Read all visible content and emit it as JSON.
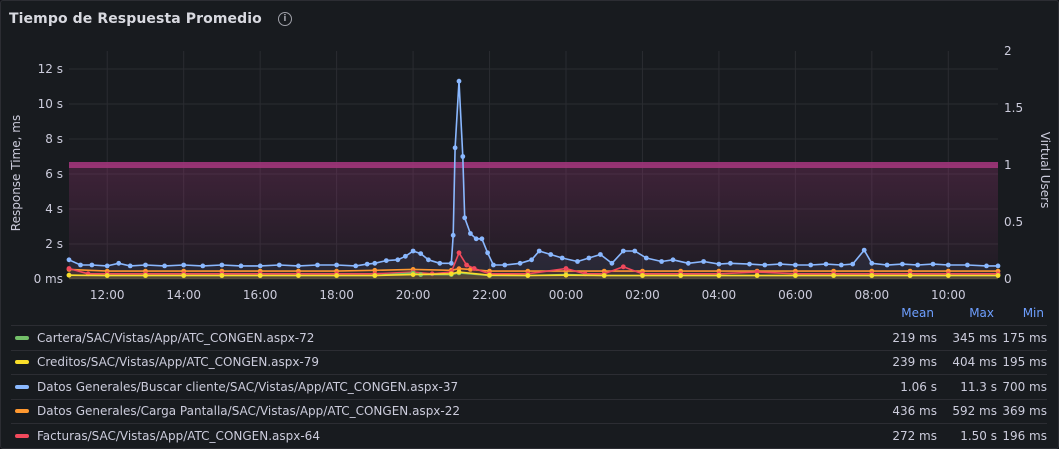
{
  "panel": {
    "title": "Tiempo de Respuesta Promedio",
    "info_icon": "info-icon"
  },
  "legend": {
    "headers": {
      "mean": "Mean",
      "max": "Max",
      "min": "Min"
    },
    "items": [
      {
        "name": "Cartera/SAC/Vistas/App/ATC_CONGEN.aspx-72",
        "color": "#73bf69",
        "mean": "219 ms",
        "max": "345 ms",
        "min": "175 ms"
      },
      {
        "name": "Creditos/SAC/Vistas/App/ATC_CONGEN.aspx-79",
        "color": "#fade2a",
        "mean": "239 ms",
        "max": "404 ms",
        "min": "195 ms"
      },
      {
        "name": "Datos Generales/Buscar cliente/SAC/Vistas/App/ATC_CONGEN.aspx-37",
        "color": "#8ab8ff",
        "mean": "1.06 s",
        "max": "11.3 s",
        "min": "700 ms"
      },
      {
        "name": "Datos Generales/Carga Pantalla/SAC/Vistas/App/ATC_CONGEN.aspx-22",
        "color": "#ff9830",
        "mean": "436 ms",
        "max": "592 ms",
        "min": "369 ms"
      },
      {
        "name": "Facturas/SAC/Vistas/App/ATC_CONGEN.aspx-64",
        "color": "#f2495c",
        "mean": "272 ms",
        "max": "1.50 s",
        "min": "196 ms"
      }
    ]
  },
  "chart_data": {
    "type": "line",
    "ylabel": "Response Time, ms",
    "y2label": "Virtual Users",
    "ylim": [
      0,
      13
    ],
    "y2lim": [
      0,
      2
    ],
    "y_ticks": [
      "0 ms",
      "2 s",
      "4 s",
      "6 s",
      "8 s",
      "10 s",
      "12 s"
    ],
    "y_tick_values": [
      0,
      2,
      4,
      6,
      8,
      10,
      12
    ],
    "y2_ticks": [
      "0",
      "0.5",
      "1",
      "1.5",
      "2"
    ],
    "y2_tick_values": [
      0,
      0.5,
      1,
      1.5,
      2
    ],
    "x_ticks": [
      "12:00",
      "14:00",
      "16:00",
      "18:00",
      "20:00",
      "22:00",
      "00:00",
      "02:00",
      "04:00",
      "06:00",
      "08:00",
      "10:00"
    ],
    "x_start_hour": 11.0,
    "x_end_hour": 35.3,
    "grid": true,
    "colors": {
      "vu": "#a1357a"
    },
    "vu_series": {
      "name": "Virtual Users",
      "value": 1
    },
    "series": [
      {
        "name": "Datos Generales/Buscar cliente/SAC/Vistas/App/ATC_CONGEN.aspx-37",
        "color": "#8ab8ff",
        "points": [
          [
            11.0,
            1.1
          ],
          [
            11.3,
            0.8
          ],
          [
            11.6,
            0.8
          ],
          [
            12.0,
            0.75
          ],
          [
            12.3,
            0.9
          ],
          [
            12.6,
            0.75
          ],
          [
            13.0,
            0.8
          ],
          [
            13.5,
            0.75
          ],
          [
            14.0,
            0.8
          ],
          [
            14.5,
            0.75
          ],
          [
            15.0,
            0.8
          ],
          [
            15.5,
            0.75
          ],
          [
            16.0,
            0.75
          ],
          [
            16.5,
            0.8
          ],
          [
            17.0,
            0.75
          ],
          [
            17.5,
            0.8
          ],
          [
            18.0,
            0.8
          ],
          [
            18.5,
            0.75
          ],
          [
            18.8,
            0.85
          ],
          [
            19.0,
            0.9
          ],
          [
            19.3,
            1.05
          ],
          [
            19.6,
            1.1
          ],
          [
            19.8,
            1.3
          ],
          [
            20.0,
            1.6
          ],
          [
            20.2,
            1.45
          ],
          [
            20.4,
            1.1
          ],
          [
            20.7,
            0.9
          ],
          [
            21.0,
            0.9
          ],
          [
            21.05,
            2.5
          ],
          [
            21.1,
            7.5
          ],
          [
            21.2,
            11.3
          ],
          [
            21.3,
            7.0
          ],
          [
            21.35,
            3.5
          ],
          [
            21.5,
            2.6
          ],
          [
            21.65,
            2.3
          ],
          [
            21.8,
            2.3
          ],
          [
            21.95,
            1.5
          ],
          [
            22.1,
            0.8
          ],
          [
            22.4,
            0.8
          ],
          [
            22.8,
            0.9
          ],
          [
            23.1,
            1.1
          ],
          [
            23.3,
            1.6
          ],
          [
            23.6,
            1.4
          ],
          [
            23.9,
            1.2
          ],
          [
            24.3,
            1.0
          ],
          [
            24.6,
            1.2
          ],
          [
            24.9,
            1.4
          ],
          [
            25.2,
            0.9
          ],
          [
            25.5,
            1.6
          ],
          [
            25.8,
            1.6
          ],
          [
            26.1,
            1.2
          ],
          [
            26.5,
            1.0
          ],
          [
            26.8,
            1.1
          ],
          [
            27.2,
            0.9
          ],
          [
            27.6,
            1.0
          ],
          [
            28.0,
            0.85
          ],
          [
            28.3,
            0.9
          ],
          [
            28.8,
            0.85
          ],
          [
            29.2,
            0.8
          ],
          [
            29.6,
            0.85
          ],
          [
            30.0,
            0.8
          ],
          [
            30.4,
            0.8
          ],
          [
            30.8,
            0.85
          ],
          [
            31.2,
            0.8
          ],
          [
            31.5,
            0.85
          ],
          [
            31.8,
            1.65
          ],
          [
            32.0,
            0.9
          ],
          [
            32.4,
            0.8
          ],
          [
            32.8,
            0.85
          ],
          [
            33.2,
            0.8
          ],
          [
            33.6,
            0.85
          ],
          [
            34.0,
            0.8
          ],
          [
            34.5,
            0.8
          ],
          [
            35.0,
            0.75
          ],
          [
            35.3,
            0.75
          ]
        ]
      },
      {
        "name": "Datos Generales/Carga Pantalla/SAC/Vistas/App/ATC_CONGEN.aspx-22",
        "color": "#ff9830",
        "points": [
          [
            11.0,
            0.55
          ],
          [
            12.0,
            0.45
          ],
          [
            13.0,
            0.45
          ],
          [
            14.0,
            0.45
          ],
          [
            15.0,
            0.45
          ],
          [
            16.0,
            0.45
          ],
          [
            17.0,
            0.45
          ],
          [
            18.0,
            0.45
          ],
          [
            19.0,
            0.5
          ],
          [
            20.0,
            0.55
          ],
          [
            21.0,
            0.5
          ],
          [
            21.2,
            0.59
          ],
          [
            21.5,
            0.55
          ],
          [
            22.0,
            0.45
          ],
          [
            23.0,
            0.45
          ],
          [
            24.0,
            0.45
          ],
          [
            25.0,
            0.45
          ],
          [
            26.0,
            0.45
          ],
          [
            27.0,
            0.45
          ],
          [
            28.0,
            0.45
          ],
          [
            29.0,
            0.45
          ],
          [
            30.0,
            0.45
          ],
          [
            31.0,
            0.45
          ],
          [
            32.0,
            0.45
          ],
          [
            33.0,
            0.45
          ],
          [
            34.0,
            0.45
          ],
          [
            35.3,
            0.45
          ]
        ]
      },
      {
        "name": "Facturas/SAC/Vistas/App/ATC_CONGEN.aspx-64",
        "color": "#f2495c",
        "points": [
          [
            11.0,
            0.6
          ],
          [
            11.5,
            0.3
          ],
          [
            12.0,
            0.3
          ],
          [
            13.0,
            0.3
          ],
          [
            14.0,
            0.3
          ],
          [
            15.0,
            0.3
          ],
          [
            16.0,
            0.3
          ],
          [
            17.0,
            0.3
          ],
          [
            18.0,
            0.3
          ],
          [
            19.0,
            0.3
          ],
          [
            20.0,
            0.4
          ],
          [
            20.5,
            0.3
          ],
          [
            21.0,
            0.4
          ],
          [
            21.2,
            1.5
          ],
          [
            21.4,
            0.8
          ],
          [
            21.6,
            0.6
          ],
          [
            22.0,
            0.3
          ],
          [
            23.0,
            0.3
          ],
          [
            24.0,
            0.6
          ],
          [
            24.5,
            0.3
          ],
          [
            25.0,
            0.3
          ],
          [
            25.5,
            0.7
          ],
          [
            26.0,
            0.3
          ],
          [
            27.0,
            0.3
          ],
          [
            28.0,
            0.3
          ],
          [
            29.0,
            0.4
          ],
          [
            30.0,
            0.3
          ],
          [
            31.0,
            0.3
          ],
          [
            32.0,
            0.3
          ],
          [
            33.0,
            0.3
          ],
          [
            34.0,
            0.3
          ],
          [
            35.3,
            0.3
          ]
        ]
      },
      {
        "name": "Cartera/SAC/Vistas/App/ATC_CONGEN.aspx-72",
        "color": "#73bf69",
        "points": [
          [
            11.0,
            0.22
          ],
          [
            12.0,
            0.2
          ],
          [
            13.0,
            0.2
          ],
          [
            14.0,
            0.2
          ],
          [
            15.0,
            0.2
          ],
          [
            16.0,
            0.2
          ],
          [
            17.0,
            0.2
          ],
          [
            18.0,
            0.2
          ],
          [
            19.0,
            0.2
          ],
          [
            20.0,
            0.34
          ],
          [
            20.2,
            0.25
          ],
          [
            21.0,
            0.25
          ],
          [
            21.2,
            0.35
          ],
          [
            22.0,
            0.2
          ],
          [
            23.0,
            0.2
          ],
          [
            24.0,
            0.25
          ],
          [
            25.0,
            0.2
          ],
          [
            26.0,
            0.2
          ],
          [
            27.0,
            0.2
          ],
          [
            28.0,
            0.2
          ],
          [
            29.0,
            0.2
          ],
          [
            30.0,
            0.2
          ],
          [
            31.0,
            0.2
          ],
          [
            32.0,
            0.2
          ],
          [
            33.0,
            0.2
          ],
          [
            34.0,
            0.2
          ],
          [
            35.3,
            0.2
          ]
        ]
      },
      {
        "name": "Creditos/SAC/Vistas/App/ATC_CONGEN.aspx-79",
        "color": "#fade2a",
        "points": [
          [
            11.0,
            0.22
          ],
          [
            12.0,
            0.2
          ],
          [
            13.0,
            0.2
          ],
          [
            14.0,
            0.2
          ],
          [
            15.0,
            0.2
          ],
          [
            16.0,
            0.2
          ],
          [
            17.0,
            0.2
          ],
          [
            18.0,
            0.2
          ],
          [
            19.0,
            0.2
          ],
          [
            20.0,
            0.25
          ],
          [
            21.0,
            0.3
          ],
          [
            21.2,
            0.4
          ],
          [
            22.0,
            0.22
          ],
          [
            23.0,
            0.2
          ],
          [
            24.0,
            0.22
          ],
          [
            25.0,
            0.2
          ],
          [
            26.0,
            0.2
          ],
          [
            27.0,
            0.2
          ],
          [
            28.0,
            0.2
          ],
          [
            29.0,
            0.2
          ],
          [
            30.0,
            0.2
          ],
          [
            31.0,
            0.2
          ],
          [
            32.0,
            0.2
          ],
          [
            33.0,
            0.2
          ],
          [
            34.0,
            0.2
          ],
          [
            35.3,
            0.2
          ]
        ]
      }
    ]
  }
}
